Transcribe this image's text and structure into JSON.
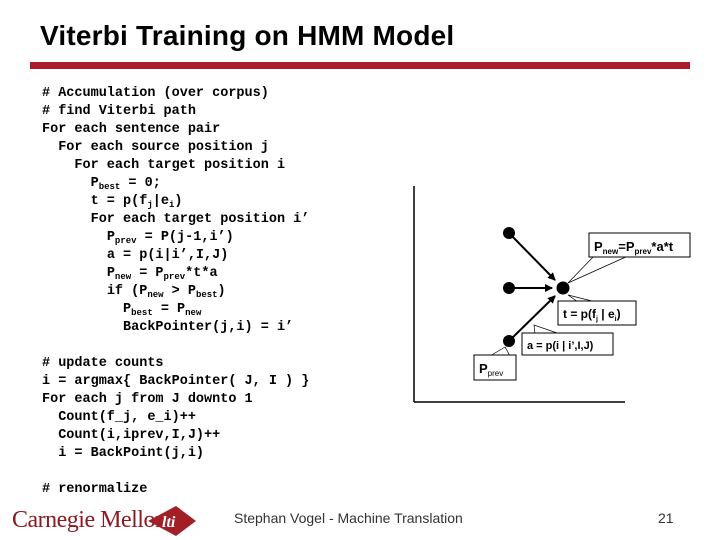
{
  "slide": {
    "title": "Viterbi Training on HMM Model",
    "accent_color": "#a91c2c"
  },
  "code_block_1": [
    {
      "indent": "",
      "parts": [
        {
          "t": "# Accumulation (over corpus)"
        }
      ]
    },
    {
      "indent": "",
      "parts": [
        {
          "t": "# find Viterbi path"
        }
      ]
    },
    {
      "indent": "",
      "parts": [
        {
          "t": "For each sentence pair"
        }
      ]
    },
    {
      "indent": "  ",
      "parts": [
        {
          "t": "For each source position j"
        }
      ]
    },
    {
      "indent": "    ",
      "parts": [
        {
          "t": "For each target position i"
        }
      ]
    },
    {
      "indent": "      ",
      "parts": [
        {
          "t": "P"
        },
        {
          "sub": "best"
        },
        {
          "t": " = 0;"
        }
      ]
    },
    {
      "indent": "      ",
      "parts": [
        {
          "t": "t = p(f"
        },
        {
          "sub": "j"
        },
        {
          "t": "|e"
        },
        {
          "sub": "i"
        },
        {
          "t": ")"
        }
      ]
    },
    {
      "indent": "      ",
      "parts": [
        {
          "t": "For each target position i’"
        }
      ]
    },
    {
      "indent": "        ",
      "parts": [
        {
          "t": "P"
        },
        {
          "sub": "prev"
        },
        {
          "t": " = P(j-1,i’)"
        }
      ]
    },
    {
      "indent": "        ",
      "parts": [
        {
          "t": "a = p(i|i’,I,J)"
        }
      ]
    },
    {
      "indent": "        ",
      "parts": [
        {
          "t": "P"
        },
        {
          "sub": "new"
        },
        {
          "t": " = P"
        },
        {
          "sub": "prev"
        },
        {
          "t": "*t*a"
        }
      ]
    },
    {
      "indent": "        ",
      "parts": [
        {
          "t": "if (P"
        },
        {
          "sub": "new"
        },
        {
          "t": " > P"
        },
        {
          "sub": "best"
        },
        {
          "t": ")"
        }
      ]
    },
    {
      "indent": "          ",
      "parts": [
        {
          "t": "P"
        },
        {
          "sub": "best"
        },
        {
          "t": " = P"
        },
        {
          "sub": "new"
        }
      ]
    },
    {
      "indent": "          ",
      "parts": [
        {
          "t": "BackPointer(j,i) = i’"
        }
      ]
    }
  ],
  "code_block_2": [
    {
      "indent": "",
      "parts": [
        {
          "t": "# update counts"
        }
      ]
    },
    {
      "indent": "",
      "parts": [
        {
          "t": "i = argmax{ BackPointer( J, I ) }"
        }
      ]
    },
    {
      "indent": "",
      "parts": [
        {
          "t": "For each j from J downto 1"
        }
      ]
    },
    {
      "indent": "  ",
      "parts": [
        {
          "t": "Count(f_j, e_i)++"
        }
      ]
    },
    {
      "indent": "  ",
      "parts": [
        {
          "t": "Count(i,iprev,I,J)++"
        }
      ]
    },
    {
      "indent": "  ",
      "parts": [
        {
          "t": "i = BackPoint(j,i)"
        }
      ]
    },
    {
      "indent": "",
      "parts": [
        {
          "t": ""
        }
      ]
    },
    {
      "indent": "",
      "parts": [
        {
          "t": "# renormalize"
        }
      ]
    }
  ],
  "diagram": {
    "callouts": {
      "p_new": {
        "main": "P",
        "sub1": "new",
        "mid": "=P",
        "sub2": "prev",
        "tail": "*a*t"
      },
      "t": {
        "main": "t = p(f",
        "sub1": "j",
        "mid": " | e",
        "sub2": "i",
        "tail": ")"
      },
      "a": {
        "text": "a = p(i | i’,I,J)"
      },
      "p_prev": {
        "main": "P",
        "sub": "prev"
      }
    }
  },
  "footer": {
    "logo_text": "Carnegie Mellon",
    "lti_text": "lti",
    "center_text": "Stephan Vogel - Machine Translation",
    "page_number": "21"
  }
}
